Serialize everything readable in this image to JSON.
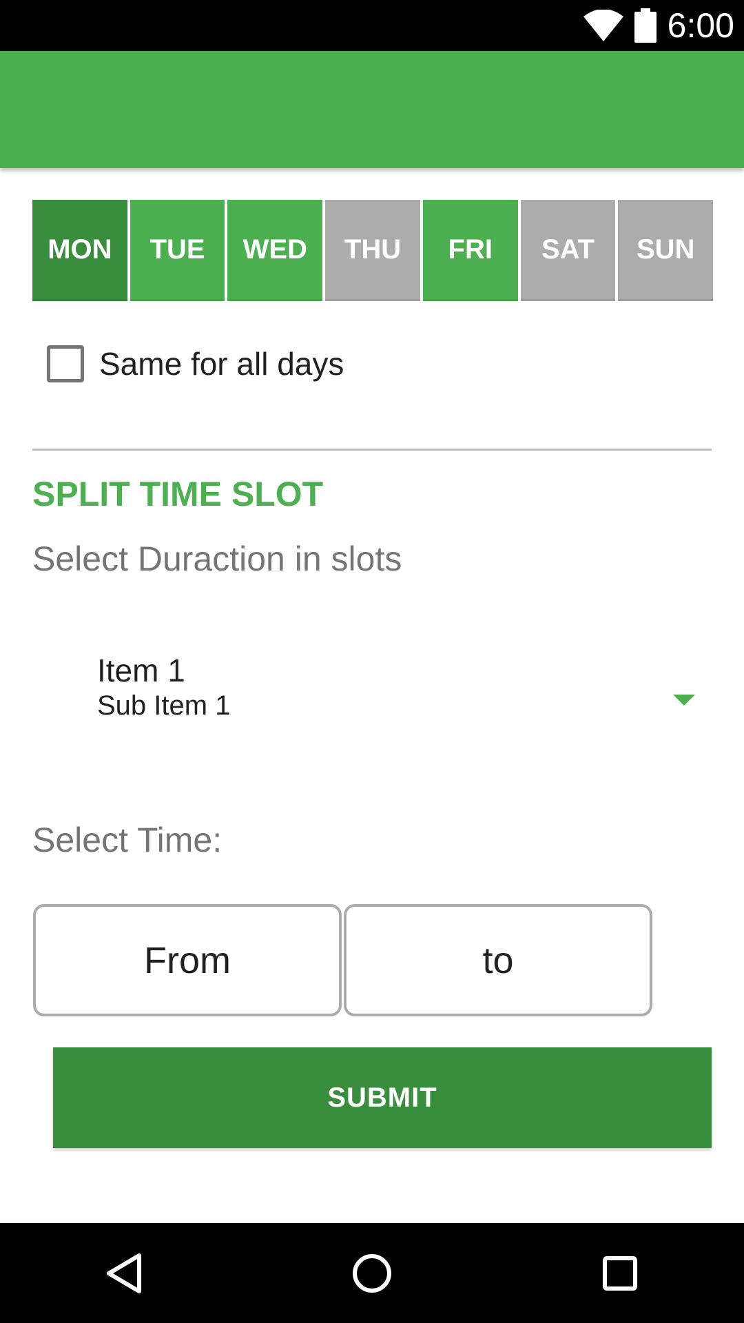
{
  "status_bar": {
    "time": "6:00",
    "wifi_icon": "wifi-icon",
    "battery_icon": "battery-icon"
  },
  "app_bar": {
    "color": "#4caf50"
  },
  "days": [
    {
      "label": "MON",
      "state": "current"
    },
    {
      "label": "TUE",
      "state": "active"
    },
    {
      "label": "WED",
      "state": "active"
    },
    {
      "label": "THU",
      "state": "inactive"
    },
    {
      "label": "FRI",
      "state": "active"
    },
    {
      "label": "SAT",
      "state": "inactive"
    },
    {
      "label": "SUN",
      "state": "inactive"
    }
  ],
  "same_for_all": {
    "label": "Same for all days",
    "checked": false
  },
  "section": {
    "title": "SPLIT TIME SLOT",
    "duration_label": "Select Duraction in slots"
  },
  "spinner": {
    "item": "Item 1",
    "sub_item": "Sub Item 1"
  },
  "time": {
    "label": "Select Time:",
    "from": "From",
    "to": "to"
  },
  "submit_label": "SUBMIT",
  "colors": {
    "primary": "#4caf50",
    "primary_dark": "#388e3c",
    "inactive": "#acacac"
  },
  "nav": {
    "back_icon": "back-icon",
    "home_icon": "home-icon",
    "recent_icon": "recent-apps-icon"
  }
}
